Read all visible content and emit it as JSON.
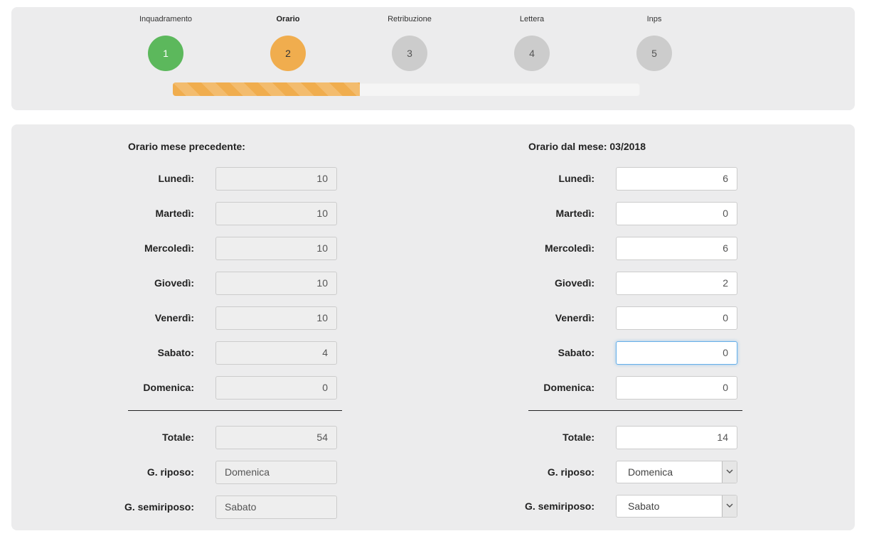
{
  "wizard": {
    "steps": [
      {
        "label": "Inquadramento",
        "number": "1",
        "state": "done"
      },
      {
        "label": "Orario",
        "number": "2",
        "state": "current"
      },
      {
        "label": "Retribuzione",
        "number": "3",
        "state": "todo"
      },
      {
        "label": "Lettera",
        "number": "4",
        "state": "todo"
      },
      {
        "label": "Inps",
        "number": "5",
        "state": "todo"
      }
    ],
    "progress_percent": 40,
    "colors": {
      "done": "#5cb85c",
      "current": "#f0ad4e",
      "todo": "#cccccc"
    }
  },
  "previous": {
    "title": "Orario mese precedente:",
    "days": [
      {
        "label": "Lunedì:",
        "value": "10"
      },
      {
        "label": "Martedì:",
        "value": "10"
      },
      {
        "label": "Mercoledì:",
        "value": "10"
      },
      {
        "label": "Giovedì:",
        "value": "10"
      },
      {
        "label": "Venerdì:",
        "value": "10"
      },
      {
        "label": "Sabato:",
        "value": "4"
      },
      {
        "label": "Domenica:",
        "value": "0"
      }
    ],
    "total_label": "Totale:",
    "total_value": "54",
    "riposo_label": "G. riposo:",
    "riposo_value": "Domenica",
    "semiriposo_label": "G. semiriposo:",
    "semiriposo_value": "Sabato"
  },
  "current": {
    "title": "Orario dal mese: 03/2018",
    "days": [
      {
        "label": "Lunedì:",
        "value": "6"
      },
      {
        "label": "Martedì:",
        "value": "0"
      },
      {
        "label": "Mercoledì:",
        "value": "6"
      },
      {
        "label": "Giovedì:",
        "value": "2"
      },
      {
        "label": "Venerdì:",
        "value": "0"
      },
      {
        "label": "Sabato:",
        "value": "0"
      },
      {
        "label": "Domenica:",
        "value": "0"
      }
    ],
    "total_label": "Totale:",
    "total_value": "14",
    "riposo_label": "G. riposo:",
    "riposo_value": "Domenica",
    "semiriposo_label": "G. semiriposo:",
    "semiriposo_value": "Sabato"
  }
}
